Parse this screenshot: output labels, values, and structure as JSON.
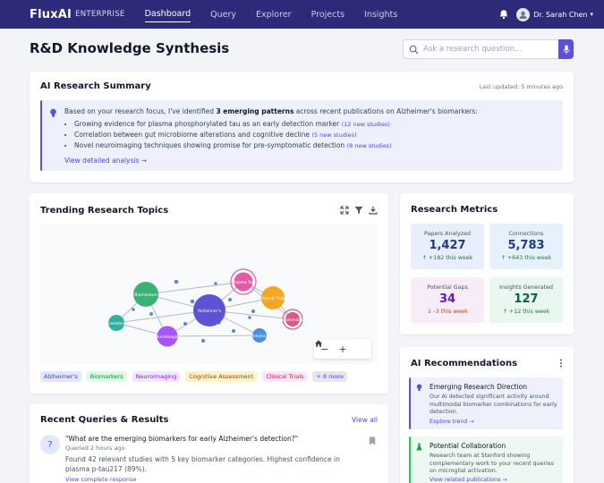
{
  "nav": {
    "brand": "FluxAI",
    "brand_sub": "ENTERPRISE",
    "links": [
      "Dashboard",
      "Query",
      "Explorer",
      "Projects",
      "Insights"
    ],
    "active": "Dashboard",
    "user_name": "Dr. Sarah Chen",
    "icons": [
      "bell-icon",
      "avatar",
      "chevron-down-icon"
    ]
  },
  "header": {
    "title": "R&D Knowledge Synthesis",
    "search_placeholder": "Ask a research question...",
    "icons": [
      "search-icon",
      "microphone-icon"
    ]
  },
  "summary": {
    "title": "AI Research Summary",
    "updated": "Last updated: 5 minutes ago",
    "intro_pre": "Based on your research focus, I've identified ",
    "intro_bold": "3 emerging patterns",
    "intro_post": " across recent publications on Alzheimer's biomarkers:",
    "bullets": [
      {
        "text": "Growing evidence for plasma phosphorylated tau as an early detection marker",
        "count": "(12 new studies)"
      },
      {
        "text": "Correlation between gut microbiome alterations and cognitive decline",
        "count": "(5 new studies)"
      },
      {
        "text": "Novel neuroimaging techniques showing promise for pre-symptomatic detection",
        "count": "(8 new studies)"
      }
    ],
    "link": "View detailed analysis →",
    "colors": {
      "accent": "#5b52d6",
      "panel": "#eef0fc"
    }
  },
  "trending": {
    "title": "Trending Research Topics",
    "tools": [
      "expand-icon",
      "filter-icon",
      "download-icon"
    ],
    "nodes": [
      {
        "label": "Alzheimer's",
        "color": "#5b52d6"
      },
      {
        "label": "Biomarkers",
        "color": "#3bb273"
      },
      {
        "label": "Plasma Tau",
        "color": "#e85aa8"
      },
      {
        "label": "Clinical Trials",
        "color": "#f5a623"
      },
      {
        "label": "Genetics",
        "color": "#2bb3a0"
      },
      {
        "label": "Neuroimaging",
        "color": "#a855f7"
      },
      {
        "label": "Inflammation",
        "color": "#e0558a"
      },
      {
        "label": "Amyloid",
        "color": "#4a90e2"
      }
    ],
    "zoom": {
      "minus": "−",
      "plus": "+"
    },
    "tags": [
      {
        "label": "Alzheimer's",
        "bg": "#e0e7ff",
        "fg": "#4338ca"
      },
      {
        "label": "Biomarkers",
        "bg": "#dcfce7",
        "fg": "#15803d"
      },
      {
        "label": "Neuroimaging",
        "bg": "#f3e8ff",
        "fg": "#7e22ce"
      },
      {
        "label": "Cognitive Assessment",
        "bg": "#fef3c7",
        "fg": "#92400e"
      },
      {
        "label": "Clinical Trials",
        "bg": "#fce7f3",
        "fg": "#be185d"
      },
      {
        "label": "+ 8 more",
        "bg": "#e5e7eb",
        "fg": "#4f46e5"
      }
    ]
  },
  "queries": {
    "title": "Recent Queries & Results",
    "view_all": "View all",
    "items": [
      {
        "badge": "?",
        "question": "\"What are the emerging biomarkers for early Alzheimer's detection?\"",
        "time": "Queried 2 hours ago",
        "result": "Found 42 relevant studies with 5 key biomarker categories. Highest confidence in plasma p-tau217 (89%).",
        "link": "View complete response"
      }
    ]
  },
  "metrics": {
    "title": "Research Metrics",
    "items": [
      {
        "label": "Papers Analyzed",
        "value": "1,427",
        "change": "↑ +182 this week",
        "bg": "#e8eefc",
        "val_color": "#1e3a8a",
        "chg_color": "#15803d"
      },
      {
        "label": "Connections",
        "value": "5,783",
        "change": "↑ +643 this week",
        "bg": "#e6f2fb",
        "val_color": "#1e3a8a",
        "chg_color": "#15803d"
      },
      {
        "label": "Potential Gaps",
        "value": "34",
        "change": "↓ -3 this week",
        "bg": "#f7ecf8",
        "val_color": "#5b21b6",
        "chg_color": "#c2410c"
      },
      {
        "label": "Insights Generated",
        "value": "127",
        "change": "↑ +12 this week",
        "bg": "#e8f7ef",
        "val_color": "#065f46",
        "chg_color": "#15803d"
      }
    ]
  },
  "recs": {
    "title": "AI Recommendations",
    "items": [
      {
        "title": "Emerging Research Direction",
        "body": "Our AI detected significant activity around multimodal biomarker combinations for early detection.",
        "link": "Explore trend →",
        "bg": "#eef0fc",
        "border": "#5b52d6",
        "icon": "bulb-icon"
      },
      {
        "title": "Potential Collaboration",
        "body": "Research team at Stanford showing complementary work to your recent queries on microglial activation.",
        "link": "View related publications →",
        "bg": "#ecf8f1",
        "border": "#22c55e",
        "icon": "flask-icon"
      }
    ]
  }
}
